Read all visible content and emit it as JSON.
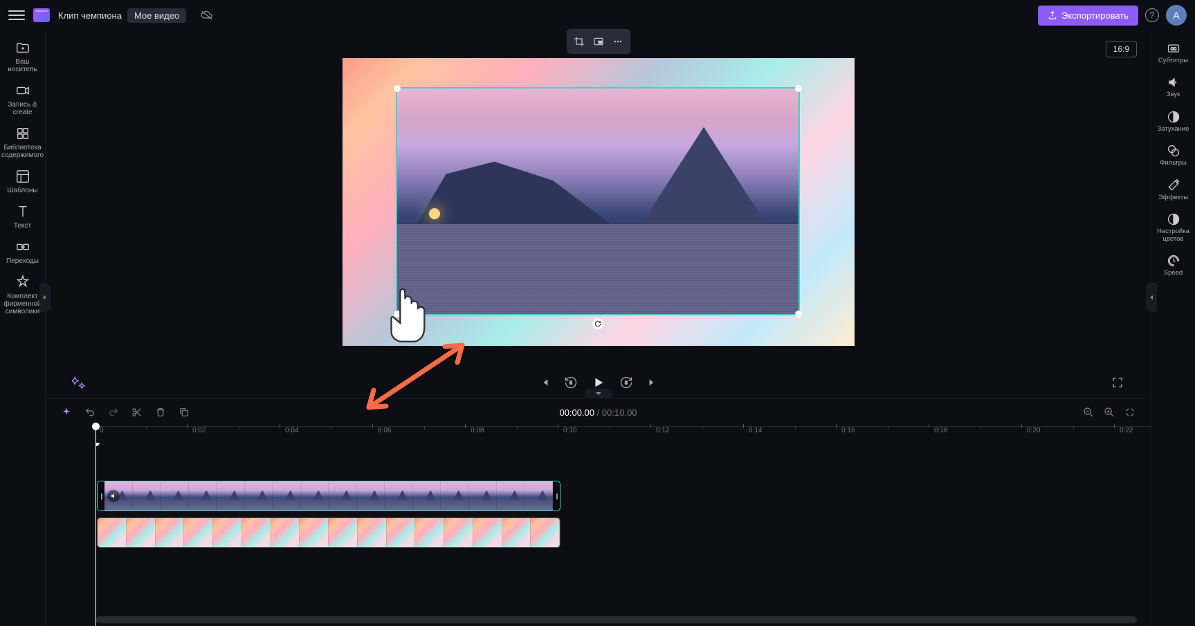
{
  "header": {
    "project_title": "Клип чемпиона",
    "project_badge": "Мое видео",
    "export_label": "Экспортировать",
    "avatar_letter": "A"
  },
  "left_panel": {
    "items": [
      {
        "label": "Ваш носитель",
        "icon": "folder-plus"
      },
      {
        "label": "Запись &amp; create",
        "icon": "camera"
      },
      {
        "label": "Библиотека содержимого",
        "icon": "library"
      },
      {
        "label": "Шаблоны",
        "icon": "templates"
      },
      {
        "label": "Текст",
        "icon": "text"
      },
      {
        "label": "Переходы",
        "icon": "transitions"
      },
      {
        "label": "Комплект фирменной символики",
        "icon": "brand"
      }
    ]
  },
  "right_panel": {
    "items": [
      {
        "label": "Субтитры",
        "icon": "cc"
      },
      {
        "label": "Звук",
        "icon": "speaker"
      },
      {
        "label": "Затухание",
        "icon": "fade"
      },
      {
        "label": "Фильтры",
        "icon": "filters"
      },
      {
        "label": "Эффекты",
        "icon": "effects"
      },
      {
        "label": "Настройка цветов",
        "icon": "color-adjust"
      },
      {
        "label": "Speed",
        "icon": "speed"
      }
    ]
  },
  "preview": {
    "aspect_ratio": "16:9"
  },
  "playback": {
    "current_time": "00:00.00",
    "total_time": "00:10.00",
    "separator": " / "
  },
  "timeline": {
    "ticks": [
      "0",
      "0:02",
      "0:04",
      "0:06",
      "0:08",
      "0:10",
      "0:12",
      "0:14",
      "0:16",
      "0:18",
      "0:20",
      "0:22"
    ]
  }
}
